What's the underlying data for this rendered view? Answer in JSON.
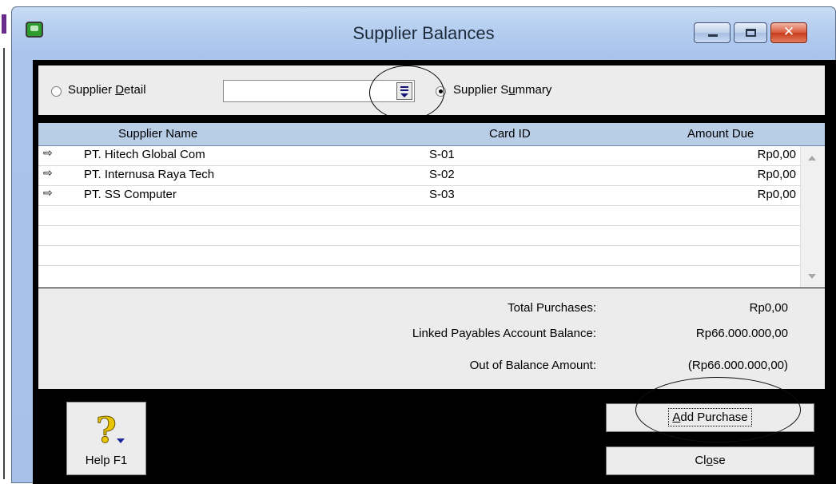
{
  "window": {
    "title": "Supplier Balances"
  },
  "options": {
    "detail_label_pre": "Supplier ",
    "detail_label_ul": "D",
    "detail_label_post": "etail",
    "detail_selected": false,
    "supplier_value": "",
    "summary_label_pre": "Supplier S",
    "summary_label_ul": "u",
    "summary_label_post": "mmary",
    "summary_selected": true
  },
  "table": {
    "columns": [
      "Supplier Name",
      "Card ID",
      "Amount Due"
    ],
    "rows": [
      {
        "name": "PT. Hitech Global Com",
        "card_id": "S-01",
        "amount": "Rp0,00"
      },
      {
        "name": "PT. Internusa Raya Tech",
        "card_id": "S-02",
        "amount": "Rp0,00"
      },
      {
        "name": "PT. SS Computer",
        "card_id": "S-03",
        "amount": "Rp0,00"
      }
    ],
    "row_icon": "arrow-right-icon"
  },
  "totals": {
    "total_purchases_label": "Total Purchases:",
    "total_purchases_value": "Rp0,00",
    "linked_label": "Linked Payables Account Balance:",
    "linked_value": "Rp66.000.000,00",
    "out_label": "Out of Balance Amount:",
    "out_value": "(Rp66.000.000,00)"
  },
  "buttons": {
    "help": "Help F1",
    "add_pre": "",
    "add_ul": "A",
    "add_post": "dd Purchase",
    "close_pre": "Cl",
    "close_ul": "o",
    "close_post": "se"
  },
  "colors": {
    "header_bg": "#b8cde6",
    "panel_bg": "#ececec",
    "client_bg": "#000000",
    "close_button": "#d9583a"
  }
}
